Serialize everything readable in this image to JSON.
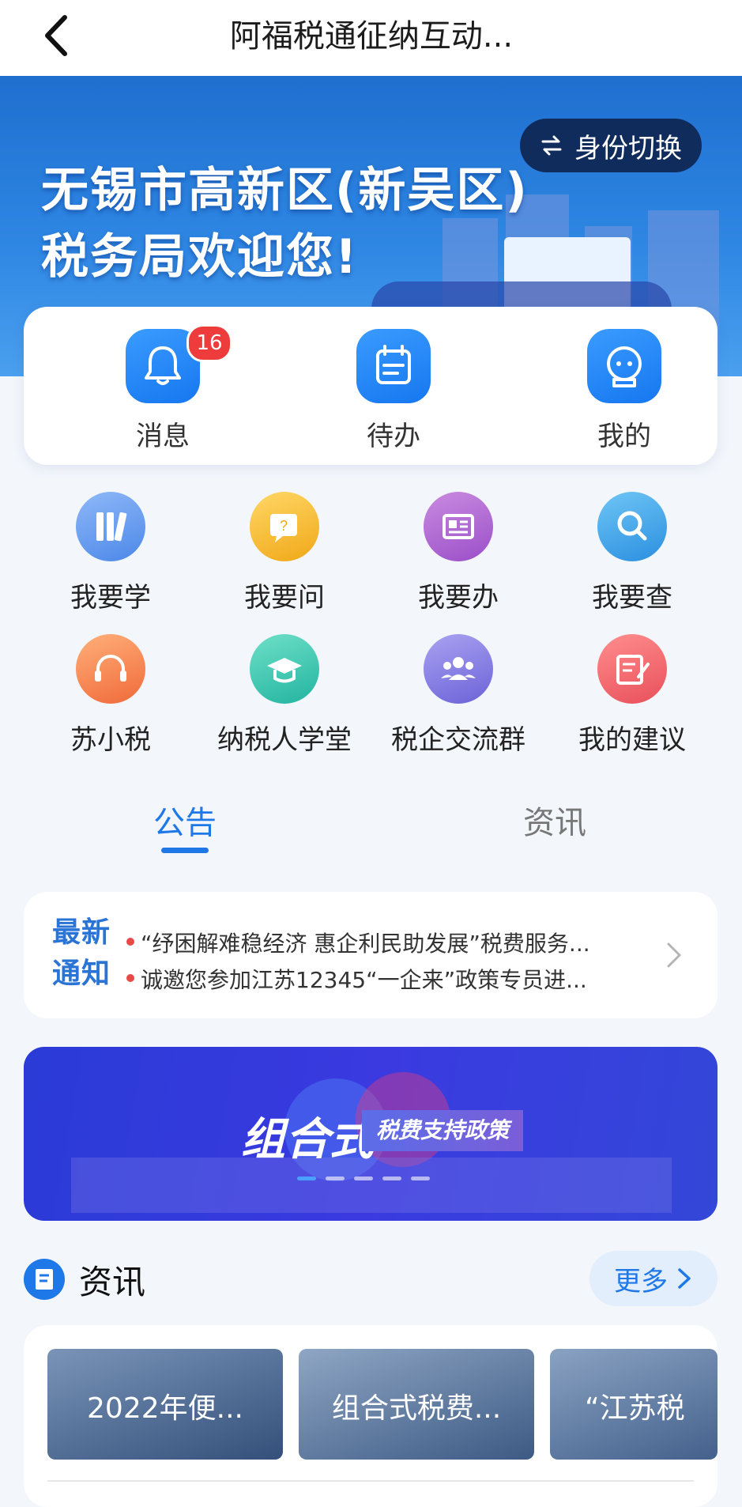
{
  "header": {
    "title": "阿福税通征纳互动..."
  },
  "banner": {
    "line1": "无锡市高新区(新吴区)",
    "line2": "税务局欢迎您!",
    "switch_label": "身份切换"
  },
  "quick_actions": [
    {
      "label": "消息",
      "badge": "16"
    },
    {
      "label": "待办"
    },
    {
      "label": "我的"
    }
  ],
  "services": [
    {
      "label": "我要学"
    },
    {
      "label": "我要问"
    },
    {
      "label": "我要办"
    },
    {
      "label": "我要查"
    },
    {
      "label": "苏小税"
    },
    {
      "label": "纳税人学堂"
    },
    {
      "label": "税企交流群"
    },
    {
      "label": "我的建议"
    }
  ],
  "tabs": [
    {
      "label": "公告",
      "active": true
    },
    {
      "label": "资讯",
      "active": false
    }
  ],
  "notice": {
    "tag_line1": "最新",
    "tag_line2": "通知",
    "items": [
      "“纾困解难稳经济 惠企利民助发展”税费服务...",
      "诚邀您参加江苏12345“一企来”政策专员进..."
    ]
  },
  "promo": {
    "text": "组合式",
    "subtext": "税费支持政策",
    "slides": 5,
    "active_slide": 1
  },
  "info": {
    "title": "资讯",
    "more_label": "更多",
    "cards": [
      "2022年便...",
      "组合式税费...",
      "“江苏税"
    ]
  },
  "colors": {
    "accent": "#1f78e8",
    "badge": "#ee3b3b",
    "banner": "#2e86e3",
    "promo": "#3a3ae0"
  }
}
